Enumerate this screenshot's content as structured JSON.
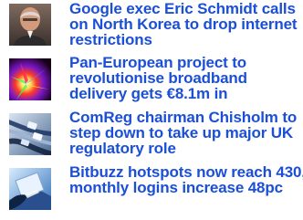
{
  "news": {
    "items": [
      {
        "headline": "Google exec Eric Schmidt calls on North Korea to drop internet restrictions",
        "thumbnail": "portrait-thumbnail-icon"
      },
      {
        "headline": "Pan-European project to revolutionise broadband delivery gets €8.1m in",
        "thumbnail": "colorful-light-burst-thumbnail-icon"
      },
      {
        "headline": "ComReg chairman Chisholm to step down to take up major UK regulatory role",
        "thumbnail": "network-cables-thumbnail-icon"
      },
      {
        "headline": "Bitbuzz hotspots now reach 430, monthly logins increase 48pc",
        "thumbnail": "laptop-user-thumbnail-icon"
      }
    ]
  }
}
